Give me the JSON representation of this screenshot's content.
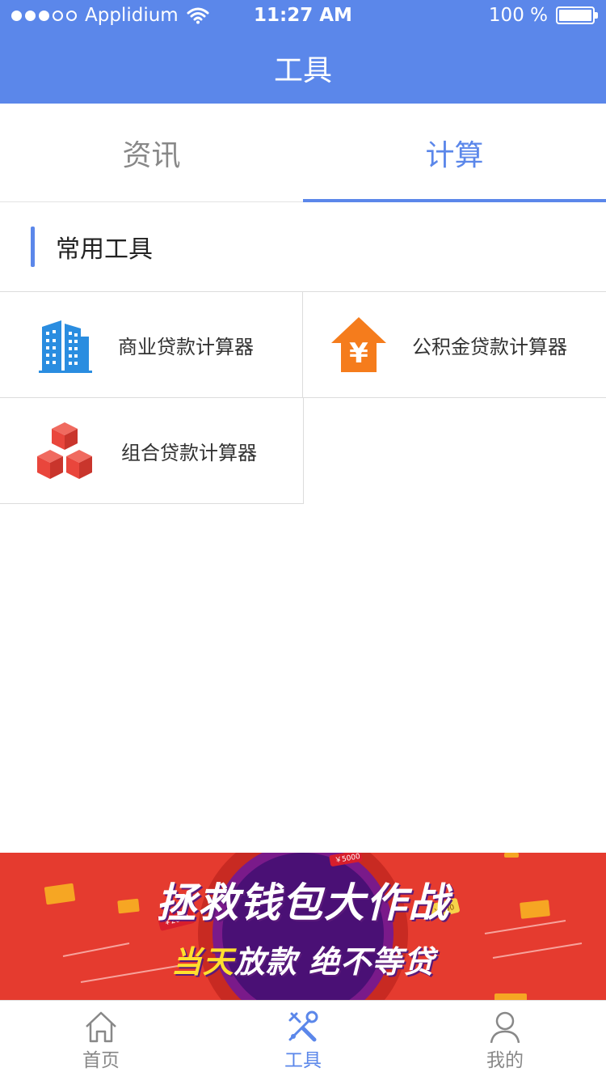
{
  "status_bar": {
    "carrier": "Applidium",
    "time": "11:27 AM",
    "battery": "100 %"
  },
  "nav": {
    "title": "工具"
  },
  "tabs": [
    {
      "label": "资讯",
      "active": false
    },
    {
      "label": "计算",
      "active": true
    }
  ],
  "section": {
    "title": "常用工具"
  },
  "tools": [
    {
      "label": "商业贷款计算器",
      "icon": "building-icon"
    },
    {
      "label": "公积金贷款计算器",
      "icon": "house-yuan-icon"
    },
    {
      "label": "组合贷款计算器",
      "icon": "stacked-boxes-icon"
    }
  ],
  "banner": {
    "title": "拯救钱包大作战",
    "subtitle_highlight": "当天",
    "subtitle_rest": "放款 绝不等贷",
    "tags": [
      "￥2000",
      "￥5000",
      "￥200"
    ]
  },
  "tabbar": [
    {
      "label": "首页",
      "icon": "home-icon",
      "active": false
    },
    {
      "label": "工具",
      "icon": "tools-icon",
      "active": true
    },
    {
      "label": "我的",
      "icon": "user-icon",
      "active": false
    }
  ],
  "colors": {
    "accent": "#5b87ea",
    "building": "#2a8de0",
    "house": "#f57c1c",
    "boxes": "#e9463c",
    "banner_bg": "#e53b2f",
    "banner_circle": "#4a1075"
  }
}
